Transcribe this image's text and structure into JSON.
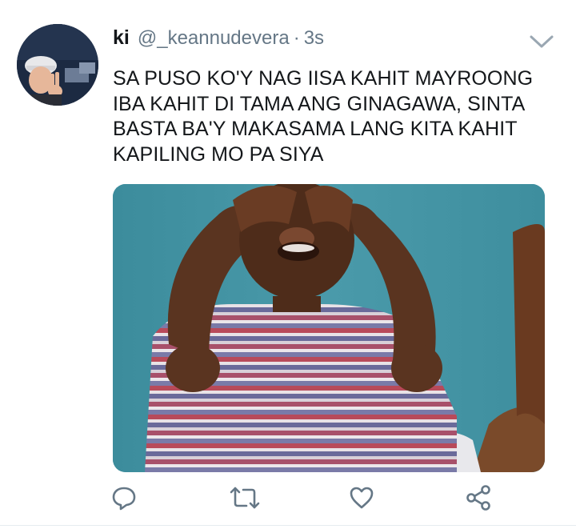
{
  "tweet": {
    "display_name": "ki",
    "handle": "@_keannudevera",
    "separator": "·",
    "time": "3s",
    "text_lines": [
      "SA PUSO KO'Y NAG IISA KAHIT MAYROONG",
      "IBA KAHIT DI TAMA ANG GINAGAWA, SINTA",
      "BASTA BA'Y MAKASAMA LANG KITA KAHIT",
      "KAPILING MO PA SIYA"
    ]
  },
  "icons": {
    "menu": "chevron-down-icon",
    "reply": "reply-icon",
    "retweet": "retweet-icon",
    "like": "heart-icon",
    "share": "share-icon"
  },
  "colors": {
    "text_primary": "#14171a",
    "text_secondary": "#657786",
    "icon_gray": "#657786",
    "media_background": "#3f8fa0"
  }
}
